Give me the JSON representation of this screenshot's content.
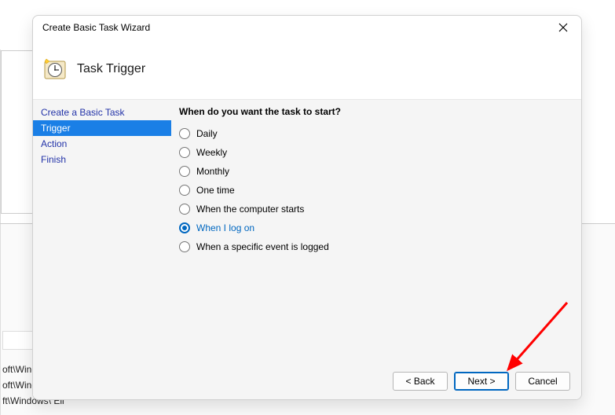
{
  "background": {
    "row2": "oft\\Winc",
    "row3": "oft\\Windows\\U...",
    "row4": "ft\\Windows\\ Eli"
  },
  "wizard": {
    "title": "Create Basic Task Wizard",
    "header": "Task Trigger"
  },
  "sidebar": {
    "items": [
      {
        "label": "Create a Basic Task",
        "selected": false
      },
      {
        "label": "Trigger",
        "selected": true
      },
      {
        "label": "Action",
        "selected": false
      },
      {
        "label": "Finish",
        "selected": false
      }
    ]
  },
  "main": {
    "prompt": "When do you want the task to start?",
    "options": [
      {
        "label": "Daily",
        "checked": false
      },
      {
        "label": "Weekly",
        "checked": false
      },
      {
        "label": "Monthly",
        "checked": false
      },
      {
        "label": "One time",
        "checked": false
      },
      {
        "label": "When the computer starts",
        "checked": false
      },
      {
        "label": "When I log on",
        "checked": true
      },
      {
        "label": "When a specific event is logged",
        "checked": false
      }
    ]
  },
  "footer": {
    "back": "< Back",
    "next": "Next >",
    "cancel": "Cancel"
  },
  "annotation": {
    "arrow_color": "#ff0000"
  }
}
